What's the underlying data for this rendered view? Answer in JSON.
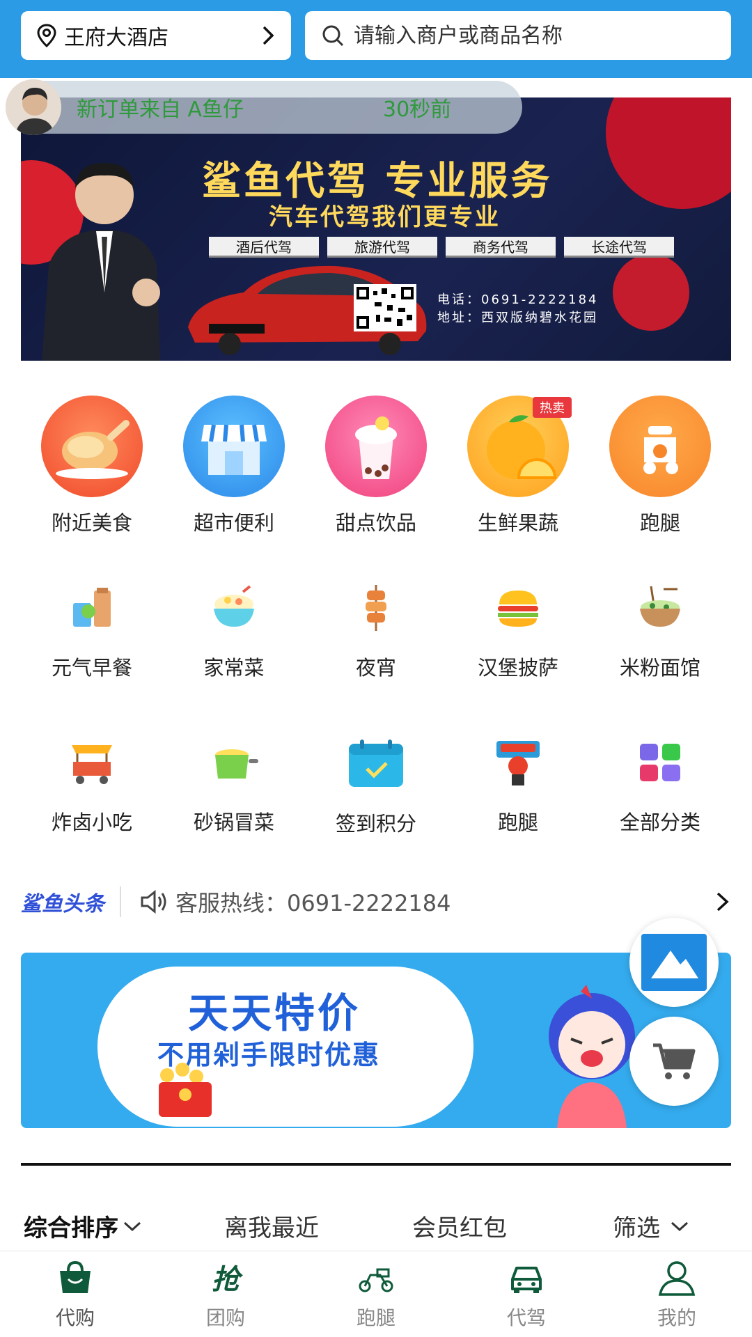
{
  "header": {
    "location": "王府大酒店",
    "search_placeholder": "请输入商户或商品名称"
  },
  "notification": {
    "text": "新订单来自 A鱼仔",
    "time": "30秒前"
  },
  "banner": {
    "title": "鲨鱼代驾 专业服务",
    "subtitle": "汽车代驾我们更专业",
    "tags": [
      "酒后代驾",
      "旅游代驾",
      "商务代驾",
      "长途代驾"
    ],
    "phone": "电话：0691-2222184",
    "address": "地址：西双版纳碧水花园"
  },
  "categories": [
    {
      "label": "附近美食",
      "icon": "roast-chicken-icon"
    },
    {
      "label": "超市便利",
      "icon": "store-icon"
    },
    {
      "label": "甜点饮品",
      "icon": "bubble-tea-icon"
    },
    {
      "label": "生鲜果蔬",
      "icon": "orange-icon",
      "badge": "热卖"
    },
    {
      "label": "跑腿",
      "icon": "scooter-icon"
    },
    {
      "label": "元气早餐",
      "icon": "breakfast-icon"
    },
    {
      "label": "家常菜",
      "icon": "rice-bowl-icon"
    },
    {
      "label": "夜宵",
      "icon": "kebab-icon"
    },
    {
      "label": "汉堡披萨",
      "icon": "burger-icon"
    },
    {
      "label": "米粉面馆",
      "icon": "noodle-bowl-icon"
    },
    {
      "label": "炸卤小吃",
      "icon": "food-cart-icon"
    },
    {
      "label": "砂锅冒菜",
      "icon": "hot-pot-icon"
    },
    {
      "label": "签到积分",
      "icon": "calendar-check-icon"
    },
    {
      "label": "跑腿",
      "icon": "delivery-rider-icon"
    },
    {
      "label": "全部分类",
      "icon": "grid-icon"
    }
  ],
  "headline": {
    "brand": "鲨鱼头条",
    "text": "客服热线：0691-2222184"
  },
  "promo": {
    "title": "天天特价",
    "subtitle": "不用剁手限时优惠"
  },
  "sort": [
    "综合排序",
    "离我最近",
    "会员红包",
    "筛选"
  ],
  "tabs": [
    {
      "label": "代购",
      "icon": "shopping-bag-icon"
    },
    {
      "label": "团购",
      "icon": "grab-icon"
    },
    {
      "label": "跑腿",
      "icon": "scooter-outline-icon"
    },
    {
      "label": "代驾",
      "icon": "car-icon"
    },
    {
      "label": "我的",
      "icon": "user-icon"
    }
  ],
  "colors": {
    "header_bg": "#2b9be6",
    "notification_text": "#2f9a3c",
    "promo_bg": "#34abee"
  }
}
